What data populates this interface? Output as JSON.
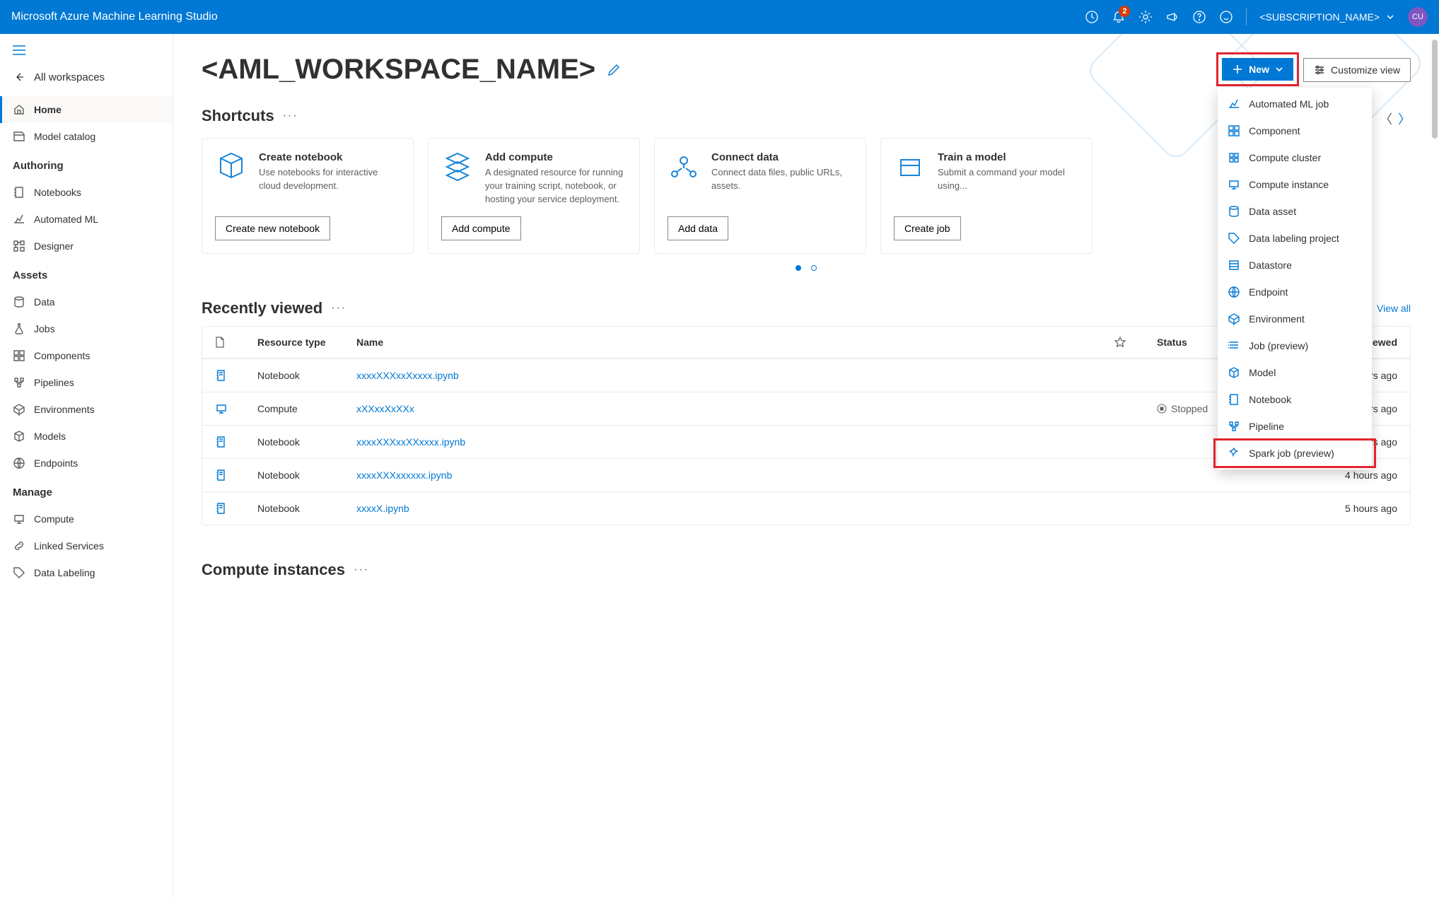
{
  "header": {
    "product": "Microsoft Azure Machine Learning Studio",
    "notification_count": "2",
    "subscription": "<SUBSCRIPTION_NAME>",
    "avatar_initials": "CU"
  },
  "sidebar": {
    "back": "All workspaces",
    "items_top": [
      {
        "label": "Home",
        "icon": "home-icon",
        "active": true
      },
      {
        "label": "Model catalog",
        "icon": "catalog-icon"
      }
    ],
    "groups": [
      {
        "heading": "Authoring",
        "items": [
          {
            "label": "Notebooks",
            "icon": "notebook-icon"
          },
          {
            "label": "Automated ML",
            "icon": "automl-icon"
          },
          {
            "label": "Designer",
            "icon": "designer-icon"
          }
        ]
      },
      {
        "heading": "Assets",
        "items": [
          {
            "label": "Data",
            "icon": "data-icon"
          },
          {
            "label": "Jobs",
            "icon": "flask-icon"
          },
          {
            "label": "Components",
            "icon": "components-icon"
          },
          {
            "label": "Pipelines",
            "icon": "pipeline-icon"
          },
          {
            "label": "Environments",
            "icon": "environment-icon"
          },
          {
            "label": "Models",
            "icon": "model-icon"
          },
          {
            "label": "Endpoints",
            "icon": "endpoint-icon"
          }
        ]
      },
      {
        "heading": "Manage",
        "items": [
          {
            "label": "Compute",
            "icon": "compute-icon"
          },
          {
            "label": "Linked Services",
            "icon": "linked-icon"
          },
          {
            "label": "Data Labeling",
            "icon": "labeling-icon"
          }
        ]
      }
    ]
  },
  "page": {
    "workspace_title": "<AML_WORKSPACE_NAME>",
    "btn_new": "New",
    "btn_customize": "Customize view"
  },
  "new_menu": [
    {
      "label": "Automated ML job",
      "icon": "automl-icon"
    },
    {
      "label": "Component",
      "icon": "components-icon"
    },
    {
      "label": "Compute cluster",
      "icon": "cluster-icon"
    },
    {
      "label": "Compute instance",
      "icon": "compute-icon"
    },
    {
      "label": "Data asset",
      "icon": "data-icon"
    },
    {
      "label": "Data labeling project",
      "icon": "labeling-icon"
    },
    {
      "label": "Datastore",
      "icon": "datastore-icon"
    },
    {
      "label": "Endpoint",
      "icon": "endpoint-icon"
    },
    {
      "label": "Environment",
      "icon": "environment-icon"
    },
    {
      "label": "Job (preview)",
      "icon": "job-icon"
    },
    {
      "label": "Model",
      "icon": "model-icon"
    },
    {
      "label": "Notebook",
      "icon": "notebook-icon"
    },
    {
      "label": "Pipeline",
      "icon": "pipeline-icon"
    },
    {
      "label": "Spark job (preview)",
      "icon": "spark-icon",
      "highlighted": true
    }
  ],
  "shortcuts": {
    "heading": "Shortcuts",
    "cards": [
      {
        "title": "Create notebook",
        "desc": "Use notebooks for interactive cloud development.",
        "button": "Create new notebook",
        "icon": "notebook-card-icon"
      },
      {
        "title": "Add compute",
        "desc": "A designated resource for running your training script, notebook, or hosting your service deployment.",
        "button": "Add compute",
        "icon": "compute-card-icon"
      },
      {
        "title": "Connect data",
        "desc": "Connect data files, public URLs, assets.",
        "button": "Add data",
        "icon": "connect-data-icon"
      },
      {
        "title": "Train a model",
        "desc": "Submit a command your model using...",
        "button": "Create job",
        "icon": "train-model-icon"
      }
    ]
  },
  "recent": {
    "heading": "Recently viewed",
    "view_all": "View all",
    "columns": {
      "type": "Resource type",
      "name": "Name",
      "status": "Status",
      "lastviewed": "Last viewed"
    },
    "rows": [
      {
        "icon": "notebook",
        "type": "Notebook",
        "name": "xxxxXXXxxXxxxx.ipynb",
        "status": "",
        "lastviewed": "hours ago"
      },
      {
        "icon": "compute",
        "type": "Compute",
        "name": "xXXxxXxXXx",
        "status": "Stopped",
        "lastviewed": "hours ago"
      },
      {
        "icon": "notebook",
        "type": "Notebook",
        "name": "xxxxXXXxxXXxxxx.ipynb",
        "status": "",
        "lastviewed": "4 hours ago"
      },
      {
        "icon": "notebook",
        "type": "Notebook",
        "name": "xxxxXXXxxxxxx.ipynb",
        "status": "",
        "lastviewed": "4 hours ago"
      },
      {
        "icon": "notebook",
        "type": "Notebook",
        "name": "xxxxX.ipynb",
        "status": "",
        "lastviewed": "5 hours ago"
      }
    ]
  },
  "compute_instances_heading": "Compute instances"
}
